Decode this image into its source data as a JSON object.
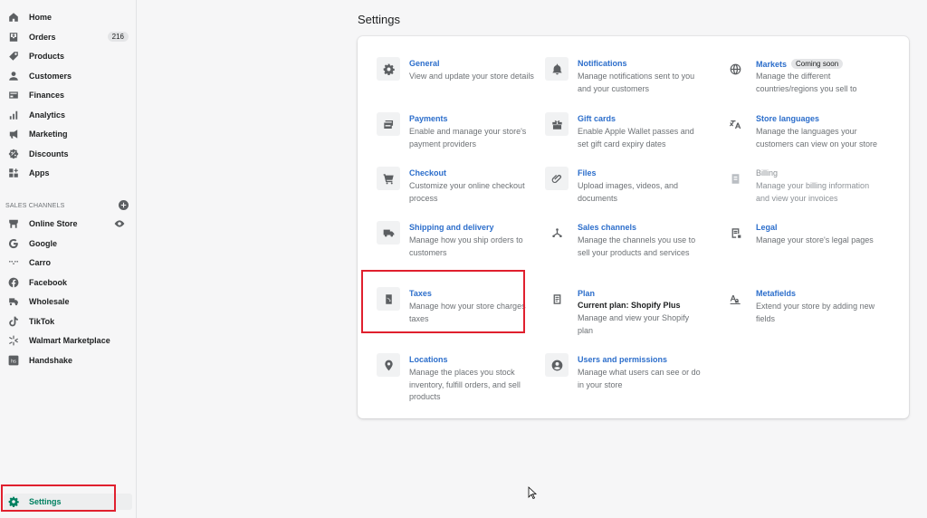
{
  "sidebar": {
    "items": [
      {
        "label": "Home",
        "icon": "home-icon"
      },
      {
        "label": "Orders",
        "icon": "orders-icon",
        "count": "216"
      },
      {
        "label": "Products",
        "icon": "tag-icon"
      },
      {
        "label": "Customers",
        "icon": "person-icon"
      },
      {
        "label": "Finances",
        "icon": "finances-icon"
      },
      {
        "label": "Analytics",
        "icon": "bar-chart-icon"
      },
      {
        "label": "Marketing",
        "icon": "megaphone-icon"
      },
      {
        "label": "Discounts",
        "icon": "discount-icon"
      },
      {
        "label": "Apps",
        "icon": "apps-icon"
      }
    ],
    "sales_channels_label": "SALES CHANNELS",
    "channels": [
      {
        "label": "Online Store",
        "icon": "store-icon"
      },
      {
        "label": "Google",
        "icon": "google-icon"
      },
      {
        "label": "Carro",
        "icon": "carro-icon"
      },
      {
        "label": "Facebook",
        "icon": "facebook-icon"
      },
      {
        "label": "Wholesale",
        "icon": "wholesale-icon"
      },
      {
        "label": "TikTok",
        "icon": "tiktok-icon"
      },
      {
        "label": "Walmart Marketplace",
        "icon": "walmart-icon"
      },
      {
        "label": "Handshake",
        "icon": "handshake-icon"
      }
    ],
    "settings_label": "Settings"
  },
  "main": {
    "title": "Settings",
    "tiles": [
      {
        "title": "General",
        "desc": "View and update your store details",
        "icon": "gear-icon"
      },
      {
        "title": "Notifications",
        "desc": "Manage notifications sent to you and your customers",
        "icon": "bell-icon"
      },
      {
        "title": "Markets",
        "badge": "Coming soon",
        "desc": "Manage the different countries/regions you sell to",
        "icon": "globe-icon"
      },
      {
        "title": "Payments",
        "desc": "Enable and manage your store's payment providers",
        "icon": "payments-icon"
      },
      {
        "title": "Gift cards",
        "desc": "Enable Apple Wallet passes and set gift card expiry dates",
        "icon": "gift-icon"
      },
      {
        "title": "Store languages",
        "desc": "Manage the languages your customers can view on your store",
        "icon": "translate-icon"
      },
      {
        "title": "Checkout",
        "desc": "Customize your online checkout process",
        "icon": "cart-icon"
      },
      {
        "title": "Files",
        "desc": "Upload images, videos, and documents",
        "icon": "paperclip-icon"
      },
      {
        "title": "Billing",
        "desc": "Manage your billing information and view your invoices",
        "icon": "billing-icon"
      },
      {
        "title": "Shipping and delivery",
        "desc": "Manage how you ship orders to customers",
        "icon": "truck-icon"
      },
      {
        "title": "Sales channels",
        "desc": "Manage the channels you use to sell your products and services",
        "icon": "channels-icon"
      },
      {
        "title": "Legal",
        "desc": "Manage your store's legal pages",
        "icon": "legal-icon"
      },
      {
        "title": "Taxes",
        "desc": "Manage how your store charges taxes",
        "icon": "taxes-icon"
      },
      {
        "title": "Plan",
        "sub": "Current plan: Shopify Plus",
        "desc": "Manage and view your Shopify plan",
        "icon": "plan-icon"
      },
      {
        "title": "Metafields",
        "desc": "Extend your store by adding new fields",
        "icon": "metafields-icon"
      },
      {
        "title": "Locations",
        "desc": "Manage the places you stock inventory, fulfill orders, and sell products",
        "icon": "location-icon"
      },
      {
        "title": "Users and permissions",
        "desc": "Manage what users can see or do in your store",
        "icon": "user-circle-icon"
      }
    ]
  },
  "colors": {
    "accent": "#008060",
    "link": "#2c6ecb",
    "highlight": "#e0202e"
  }
}
